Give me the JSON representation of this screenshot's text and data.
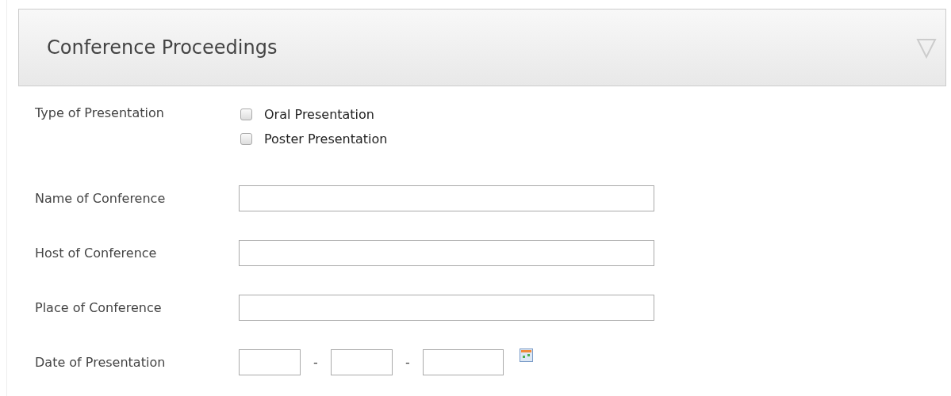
{
  "panel": {
    "title": "Conference Proceedings"
  },
  "presentation_type": {
    "label": "Type of Presentation",
    "options": [
      {
        "label": "Oral Presentation",
        "checked": false
      },
      {
        "label": "Poster Presentation",
        "checked": false
      }
    ]
  },
  "fields": [
    {
      "label": "Name of Conference"
    },
    {
      "label": "Host of Conference"
    },
    {
      "label": "Place of Conference"
    }
  ],
  "date": {
    "label": "Date of Presentation",
    "separators": [
      "-",
      "-"
    ]
  }
}
